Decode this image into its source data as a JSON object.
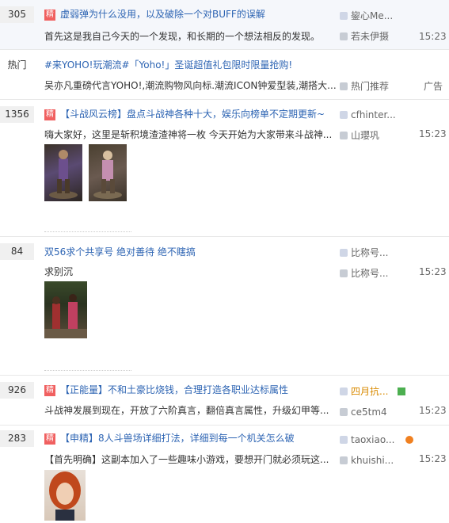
{
  "threads": [
    {
      "replies": "305",
      "jing": "精",
      "title": "虚弱弹为什么没用，以及破除一个对BUFF的误解",
      "abstract": "首先这是我自己今天的一个发现，和长期的一个想法相反的发现。 ...",
      "author": "鋆心Me...",
      "last_reply_user": "若未伊摄",
      "time": "15:23"
    },
    {
      "replies": "热门",
      "title": "#来YOHO!玩潮流#「Yoho!」圣诞超值礼包限时限量抢购!",
      "abstract": "吴亦凡重磅代言YOHO!,潮流购物风向标.潮流ICON钟爱型装,潮搭大...",
      "last_reply_user": "热门推荐",
      "time": "广告"
    },
    {
      "replies": "1356",
      "jing": "精",
      "title": "【斗战风云榜】盘点斗战神各种十大，娱乐向榜单不定期更新~",
      "abstract": "嗨大家好，这里是斩积境渣渣神将一枚 今天开始为大家带来斗战神...",
      "author": "cfhinter...",
      "last_reply_user": "山瓔巩",
      "time": "15:23"
    },
    {
      "replies": "84",
      "title": "双56求个共享号 绝对善待 绝不瞎搞",
      "abstract": "求别沉",
      "author": "比称号...",
      "last_reply_user": "比称号...",
      "time": "15:23"
    },
    {
      "replies": "926",
      "jing": "精",
      "title": "【正能量】不和土豪比烧钱，合理打造各职业达标属性",
      "abstract": "斗战神发展到现在，开放了六阶真言，翻倍真言属性，升级幻甲等...",
      "author": "四月抗...",
      "last_reply_user": "ce5tm4",
      "time": "15:23"
    },
    {
      "replies": "283",
      "jing": "精",
      "title": "【申精】8人斗兽场详细打法，详细到每一个机关怎么破",
      "abstract": "【首先明确】这副本加入了一些趣味小游戏，要想开门就必须玩这...",
      "author": "taoxiao...",
      "last_reply_user": "khuishi...",
      "time": "15:23"
    }
  ],
  "colors": {
    "link": "#2d64b3",
    "jing_badge": "#f06060",
    "orange_author": "#d98a00"
  }
}
